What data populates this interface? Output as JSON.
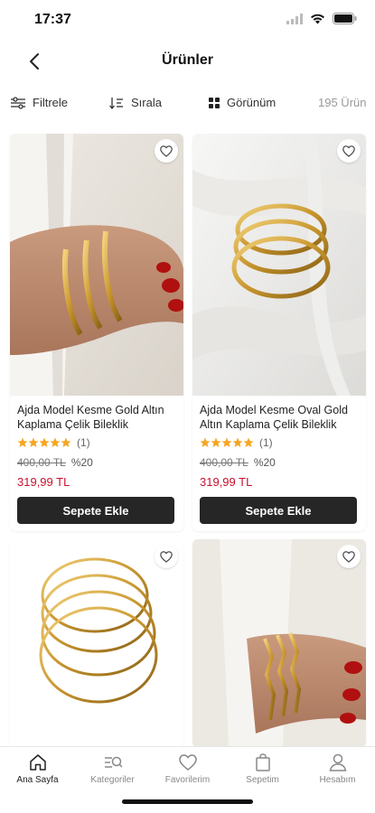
{
  "status": {
    "time": "17:37"
  },
  "header": {
    "title": "Ürünler"
  },
  "toolbar": {
    "filter_label": "Filtrele",
    "sort_label": "Sırala",
    "view_label": "Görünüm",
    "count_label": "195 Ürün"
  },
  "products": [
    {
      "name": "Ajda Model Kesme Gold Altın Kaplama Çelik Bileklik",
      "rating_count": "(1)",
      "old_price": "400,00 TL",
      "discount": "%20",
      "price": "319,99 TL",
      "button": "Sepete Ekle"
    },
    {
      "name": "Ajda Model Kesme Oval Gold Altın Kaplama Çelik Bileklik",
      "rating_count": "(1)",
      "old_price": "400,00 TL",
      "discount": "%20",
      "price": "319,99 TL",
      "button": "Sepete Ekle"
    }
  ],
  "tabbar": {
    "items": [
      {
        "label": "Ana Sayfa",
        "icon": "home-icon"
      },
      {
        "label": "Kategoriler",
        "icon": "categories-icon"
      },
      {
        "label": "Favorilerim",
        "icon": "heart-icon"
      },
      {
        "label": "Sepetim",
        "icon": "bag-icon"
      },
      {
        "label": "Hesabım",
        "icon": "user-icon"
      }
    ]
  },
  "colors": {
    "accent_price": "#c8102e",
    "button_bg": "#262626",
    "star": "#f5a623"
  }
}
